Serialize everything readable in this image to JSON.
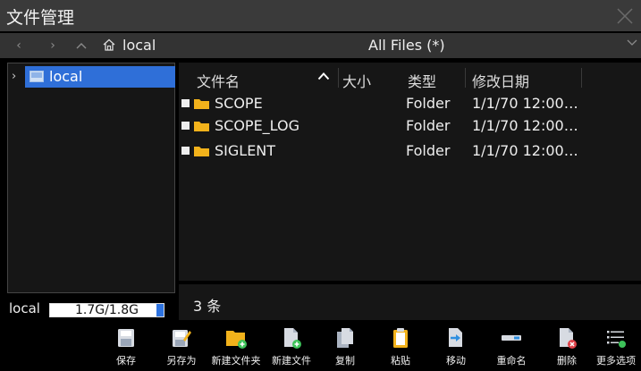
{
  "window": {
    "title": "文件管理"
  },
  "path": {
    "current": "local",
    "filter": "All Files (*)"
  },
  "tree": {
    "items": [
      {
        "label": "local"
      }
    ]
  },
  "columns": [
    {
      "label": "文件名"
    },
    {
      "label": "大小"
    },
    {
      "label": "类型"
    },
    {
      "label": "修改日期"
    }
  ],
  "files": [
    {
      "name": "SCOPE",
      "size": "",
      "type": "Folder",
      "date": "1/1/70 12:00…"
    },
    {
      "name": "SCOPE_LOG",
      "size": "",
      "type": "Folder",
      "date": "1/1/70 12:00…"
    },
    {
      "name": "SIGLENT",
      "size": "",
      "type": "Folder",
      "date": "1/1/70 12:00…"
    }
  ],
  "status": {
    "count_text": "3 条"
  },
  "storage": {
    "label": "local",
    "usage_text": "1.7G/1.8G",
    "used_fraction": 0.94
  },
  "toolbar": {
    "items": [
      {
        "label": "保存",
        "icon": "save-icon"
      },
      {
        "label": "另存为",
        "icon": "save-as-icon"
      },
      {
        "label": "新建文件夹",
        "icon": "new-folder-icon"
      },
      {
        "label": "新建文件",
        "icon": "new-file-icon"
      },
      {
        "label": "复制",
        "icon": "copy-icon"
      },
      {
        "label": "粘贴",
        "icon": "paste-icon"
      },
      {
        "label": "移动",
        "icon": "move-icon"
      },
      {
        "label": "重命名",
        "icon": "rename-icon"
      },
      {
        "label": "删除",
        "icon": "delete-icon"
      },
      {
        "label": "更多选项",
        "icon": "more-options-icon"
      }
    ]
  },
  "colors": {
    "accent": "#2f6fd8",
    "folder": "#f2b21b",
    "add_badge": "#3ec25a",
    "delete_badge": "#e0434a"
  }
}
